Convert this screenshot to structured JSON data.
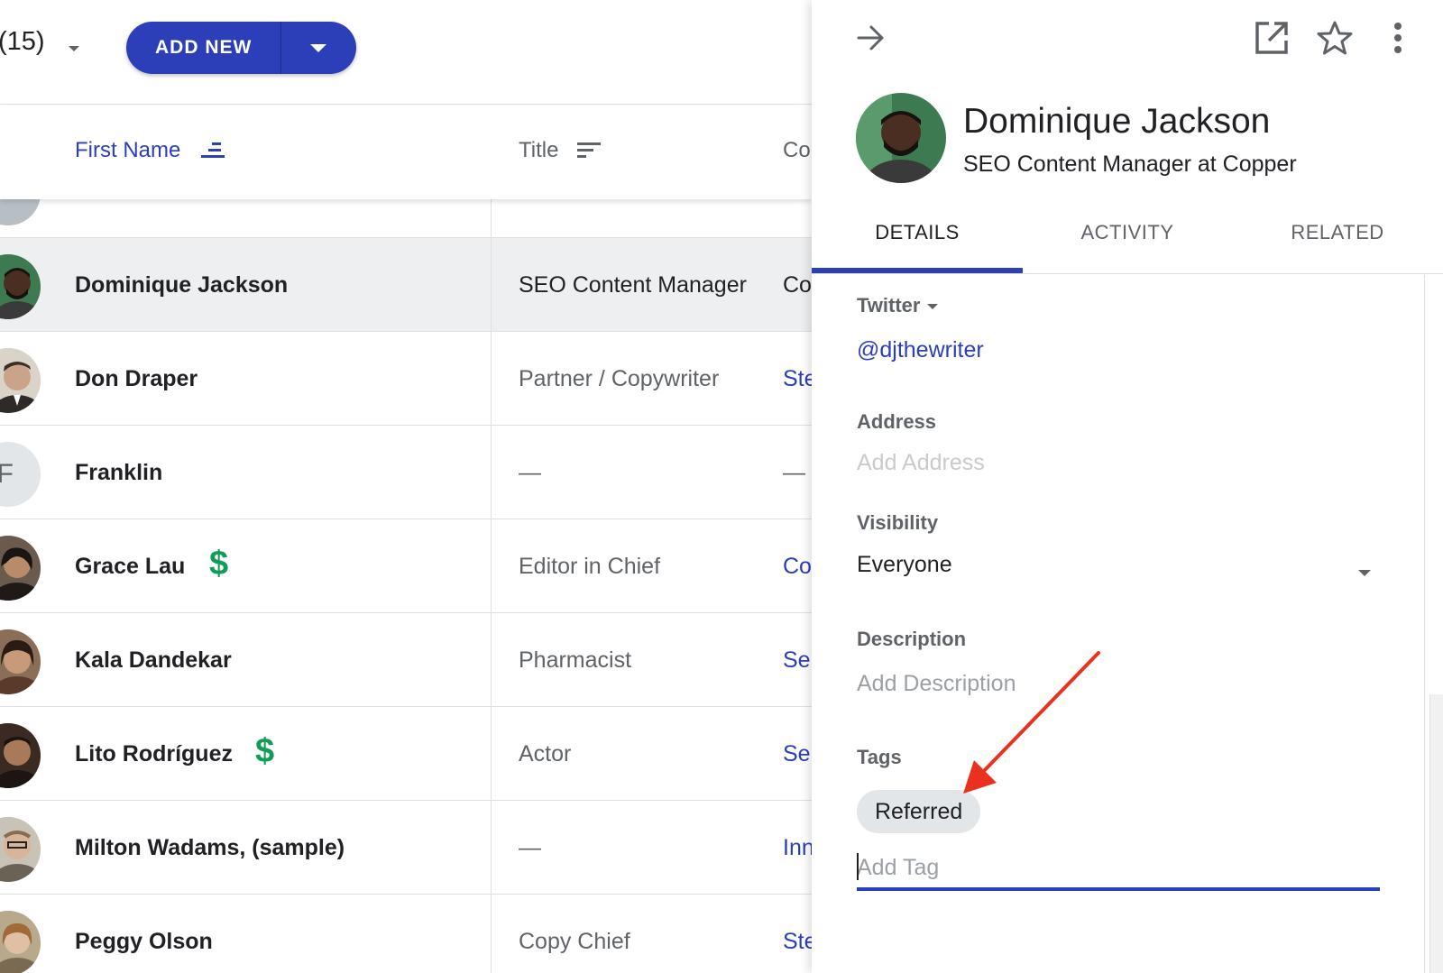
{
  "list": {
    "count_label": "(15)",
    "add_new_label": "ADD NEW",
    "columns": {
      "first_name": "First Name",
      "title": "Title",
      "company": "Co"
    },
    "rows": [
      {
        "name": "",
        "title": "",
        "company": "",
        "avatar": "photo"
      },
      {
        "name": "Dominique Jackson",
        "title": "SEO Content Manager",
        "company": "Co",
        "avatar": "photo",
        "selected": true
      },
      {
        "name": "Don Draper",
        "title": "Partner / Copywriter",
        "company": "Ste",
        "avatar": "photo"
      },
      {
        "name": "Franklin",
        "title": "—",
        "company": "—",
        "avatar": "initial",
        "initial": "F"
      },
      {
        "name": "Grace Lau",
        "title": "Editor in Chief",
        "company": "Co",
        "avatar": "photo",
        "badge": "$"
      },
      {
        "name": "Kala Dandekar",
        "title": "Pharmacist",
        "company": "Ser",
        "avatar": "photo"
      },
      {
        "name": "Lito Rodríguez",
        "title": "Actor",
        "company": "Ser",
        "avatar": "photo",
        "badge": "$"
      },
      {
        "name": "Milton Wadams, (sample)",
        "title": "—",
        "company": "Inn",
        "avatar": "photo"
      },
      {
        "name": "Peggy Olson",
        "title": "Copy Chief",
        "company": "Ste",
        "avatar": "photo"
      }
    ]
  },
  "panel": {
    "name": "Dominique Jackson",
    "subtitle": "SEO Content Manager at Copper",
    "tabs": [
      "DETAILS",
      "ACTIVITY",
      "RELATED"
    ],
    "active_tab": "DETAILS",
    "fields": {
      "twitter_label": "Twitter",
      "twitter_value": "@djthewriter",
      "address_label": "Address",
      "address_placeholder": "Add Address",
      "visibility_label": "Visibility",
      "visibility_value": "Everyone",
      "description_label": "Description",
      "description_placeholder": "Add Description",
      "tags_label": "Tags",
      "tags": [
        "Referred"
      ],
      "tag_input_placeholder": "Add Tag"
    },
    "icons": [
      "arrow-right-icon",
      "open-in-new-icon",
      "star-icon",
      "more-vert-icon"
    ]
  },
  "colors": {
    "accent": "#2c3eb8",
    "money": "#0f9d58",
    "annotation": "#e8321f"
  }
}
